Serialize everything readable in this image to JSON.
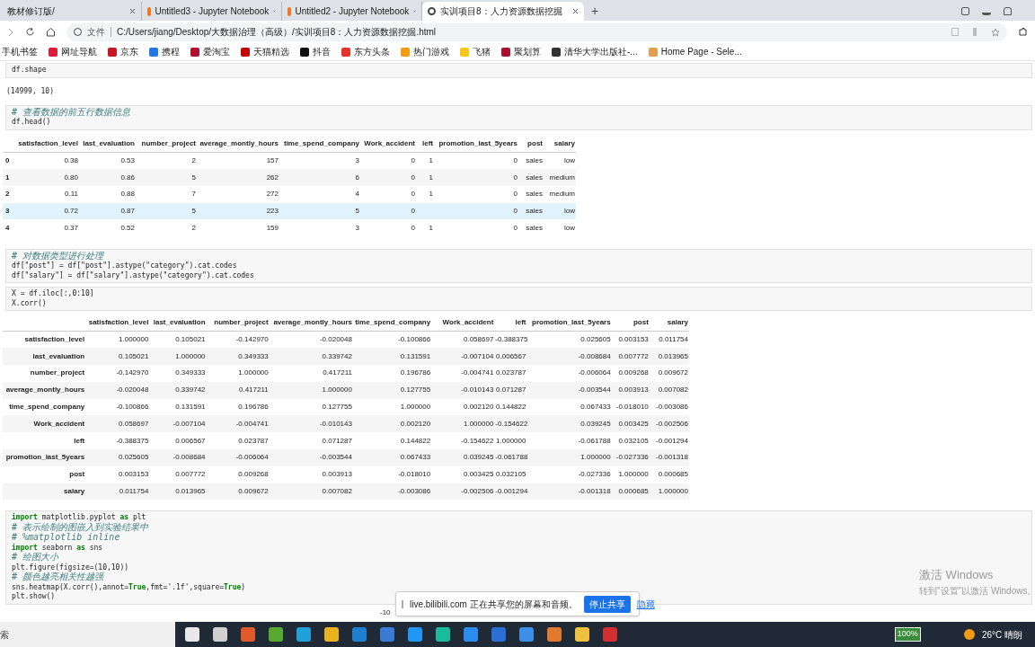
{
  "tabs": [
    {
      "label": "教材修订版/",
      "selected": false
    },
    {
      "label": "Untitled3 - Jupyter Notebook",
      "selected": false
    },
    {
      "label": "Untitled2 - Jupyter Notebook",
      "selected": false
    },
    {
      "label": "实训项目8：人力资源数据挖掘",
      "selected": true
    }
  ],
  "new_tab": "+",
  "address_bar": {
    "scheme_label": "文件",
    "url": "C:/Users/jiang/Desktop/大数据治理（高级）/实训项目8：人力资源数据挖掘.html"
  },
  "bookmarks": [
    {
      "label": "手机书签"
    },
    {
      "label": "网址导航",
      "color": "#d81e3a"
    },
    {
      "label": "京东",
      "color": "#c81623"
    },
    {
      "label": "携程",
      "color": "#2577e3"
    },
    {
      "label": "爱淘宝",
      "color": "#b0102e"
    },
    {
      "label": "天猫精选",
      "color": "#c40000"
    },
    {
      "label": "抖音",
      "color": "#111111"
    },
    {
      "label": "东方头条",
      "color": "#e8332a"
    },
    {
      "label": "热门游戏",
      "color": "#f39c12"
    },
    {
      "label": "飞猪",
      "color": "#f5c518"
    },
    {
      "label": "聚划算",
      "color": "#a8102e"
    },
    {
      "label": "清华大学出版社-...",
      "color": "#333333"
    },
    {
      "label": "Home Page - Sele...",
      "color": "#e0a050"
    }
  ],
  "notebook": {
    "cell_1": {
      "code": [
        [
          {
            "kind": "plain",
            "text": "df.shape"
          }
        ]
      ]
    },
    "output_1": "(14999, 10)",
    "cell_2": {
      "code": [
        [
          {
            "kind": "comment",
            "text": "# 查看数据的前五行数据信息"
          }
        ],
        [
          {
            "kind": "plain",
            "text": "df.head()"
          }
        ]
      ]
    },
    "head_table": {
      "columns": [
        "satisfaction_level",
        "last_evaluation",
        "number_project",
        "average_montly_hours",
        "time_spend_company",
        "Work_accident",
        "left",
        "promotion_last_5years",
        "post",
        "salary"
      ],
      "rows": [
        {
          "index": "0",
          "hovered": false,
          "cells": [
            "0.38",
            "0.53",
            "2",
            "157",
            "3",
            "0",
            "1",
            "0",
            "sales",
            "low"
          ]
        },
        {
          "index": "1",
          "hovered": false,
          "cells": [
            "0.80",
            "0.86",
            "5",
            "262",
            "6",
            "0",
            "1",
            "0",
            "sales",
            "medium"
          ]
        },
        {
          "index": "2",
          "hovered": false,
          "cells": [
            "0.11",
            "0.88",
            "7",
            "272",
            "4",
            "0",
            "1",
            "0",
            "sales",
            "medium"
          ]
        },
        {
          "index": "3",
          "hovered": true,
          "cells": [
            "0.72",
            "0.87",
            "5",
            "223",
            "5",
            "0",
            "",
            "0",
            "sales",
            "low"
          ]
        },
        {
          "index": "4",
          "hovered": false,
          "cells": [
            "0.37",
            "0.52",
            "2",
            "159",
            "3",
            "0",
            "1",
            "0",
            "sales",
            "low"
          ]
        }
      ]
    },
    "cell_3": {
      "code": [
        [
          {
            "kind": "comment",
            "text": "# 对数据类型进行处理"
          }
        ],
        [
          {
            "kind": "plain",
            "text": "df[\"post\"] = df[\"post\"].astype(\"category\").cat.codes"
          }
        ],
        [
          {
            "kind": "plain",
            "text": "df[\"salary\"] = df[\"salary\"].astype(\"category\").cat.codes"
          }
        ]
      ]
    },
    "cell_4": {
      "code": [
        [
          {
            "kind": "plain",
            "text": "X = df.iloc[:,0:10]"
          }
        ],
        [
          {
            "kind": "plain",
            "text": "X.corr()"
          }
        ]
      ]
    },
    "corr_table": {
      "columns": [
        "satisfaction_level",
        "last_evaluation",
        "number_project",
        "average_montly_hours",
        "time_spend_company",
        "Work_accident",
        "left",
        "promotion_last_5years",
        "post",
        "salary"
      ],
      "rows": [
        {
          "index": "satisfaction_level",
          "cells": [
            "1.000000",
            "0.105021",
            "-0.142970",
            "-0.020048",
            "-0.100866",
            "0.058697",
            "-0.388375",
            "0.025605",
            "0.003153",
            "0.011754"
          ]
        },
        {
          "index": "last_evaluation",
          "cells": [
            "0.105021",
            "1.000000",
            "0.349333",
            "0.339742",
            "0.131591",
            "-0.007104",
            "0.006567",
            "-0.008684",
            "0.007772",
            "0.013965"
          ]
        },
        {
          "index": "number_project",
          "cells": [
            "-0.142970",
            "0.349333",
            "1.000000",
            "0.417211",
            "0.196786",
            "-0.004741",
            "0.023787",
            "-0.006064",
            "0.009268",
            "0.009672"
          ]
        },
        {
          "index": "average_montly_hours",
          "cells": [
            "-0.020048",
            "0.339742",
            "0.417211",
            "1.000000",
            "0.127755",
            "-0.010143",
            "0.071287",
            "-0.003544",
            "0.003913",
            "0.007082"
          ]
        },
        {
          "index": "time_spend_company",
          "cells": [
            "-0.100866",
            "0.131591",
            "0.196786",
            "0.127755",
            "1.000000",
            "0.002120",
            "0.144822",
            "0.067433",
            "-0.018010",
            "-0.003086"
          ]
        },
        {
          "index": "Work_accident",
          "cells": [
            "0.058697",
            "-0.007104",
            "-0.004741",
            "-0.010143",
            "0.002120",
            "1.000000",
            "-0.154622",
            "0.039245",
            "0.003425",
            "-0.002506"
          ]
        },
        {
          "index": "left",
          "cells": [
            "-0.388375",
            "0.006567",
            "0.023787",
            "0.071287",
            "0.144822",
            "-0.154622",
            "1.000000",
            "-0.061788",
            "0.032105",
            "-0.001294"
          ]
        },
        {
          "index": "promotion_last_5years",
          "cells": [
            "0.025605",
            "-0.008684",
            "-0.006064",
            "-0.003544",
            "0.067433",
            "0.039245",
            "-0.061788",
            "1.000000",
            "-0.027336",
            "-0.001318"
          ]
        },
        {
          "index": "post",
          "cells": [
            "0.003153",
            "0.007772",
            "0.009268",
            "0.003913",
            "-0.018010",
            "0.003425",
            "0.032105",
            "-0.027336",
            "1.000000",
            "0.000685"
          ]
        },
        {
          "index": "salary",
          "cells": [
            "0.011754",
            "0.013965",
            "0.009672",
            "0.007082",
            "-0.003086",
            "-0.002506",
            "-0.001294",
            "-0.001318",
            "0.000685",
            "1.000000"
          ]
        }
      ]
    },
    "cell_5": {
      "code": [
        [
          {
            "kind": "keyword",
            "text": "import"
          },
          {
            "kind": "plain",
            "text": " matplotlib.pyplot "
          },
          {
            "kind": "keyword",
            "text": "as"
          },
          {
            "kind": "plain",
            "text": " plt"
          }
        ],
        [
          {
            "kind": "comment",
            "text": "# 表示绘制的图嵌入到实验结果中"
          }
        ],
        [
          {
            "kind": "comment",
            "text": "# %matplotlib inline"
          }
        ],
        [
          {
            "kind": "keyword",
            "text": "import"
          },
          {
            "kind": "plain",
            "text": " seaborn "
          },
          {
            "kind": "keyword",
            "text": "as"
          },
          {
            "kind": "plain",
            "text": " sns"
          }
        ],
        [
          {
            "kind": "comment",
            "text": "# 绘图大小"
          }
        ],
        [
          {
            "kind": "plain",
            "text": "plt.figure(figsize=(10,10))"
          }
        ],
        [
          {
            "kind": "comment",
            "text": "# 颜色越亮相关性越强"
          }
        ],
        [
          {
            "kind": "plain",
            "text": "sns.heatmap(X.corr(),annot="
          },
          {
            "kind": "keyword",
            "text": "True"
          },
          {
            "kind": "plain",
            "text": ",fmt='.1f',square="
          },
          {
            "kind": "keyword",
            "text": "True"
          },
          {
            "kind": "plain",
            "text": ")"
          }
        ],
        [
          {
            "kind": "plain",
            "text": "plt.show()"
          }
        ]
      ]
    },
    "partial_tick": "-10"
  },
  "share_notice": {
    "message": "live.bilibili.com 正在共享您的屏幕和音频。",
    "stop_button": "停止共享",
    "hide_link": "隐藏"
  },
  "activation": {
    "title": "激活 Windows",
    "hint": "转到\"设置\"以激活 Windows。"
  },
  "taskbar": {
    "search": "索",
    "apps": [
      {
        "color": "#e8e8e8"
      },
      {
        "color": "#d0d0d0"
      },
      {
        "color": "#e05a2b"
      },
      {
        "color": "#58a832"
      },
      {
        "color": "#1fa0d8"
      },
      {
        "color": "#e8b31c"
      },
      {
        "color": "#1e7fd0"
      },
      {
        "color": "#3a7bd5"
      },
      {
        "color": "#2196f3"
      },
      {
        "color": "#1abc9c"
      },
      {
        "color": "#2d8cf0"
      },
      {
        "color": "#2a6fd6"
      },
      {
        "color": "#3d8ee6"
      },
      {
        "color": "#e07a2e"
      },
      {
        "color": "#f0c040"
      },
      {
        "color": "#d32f2f"
      }
    ],
    "battery": "100%",
    "weather": "26°C 晴朗"
  }
}
